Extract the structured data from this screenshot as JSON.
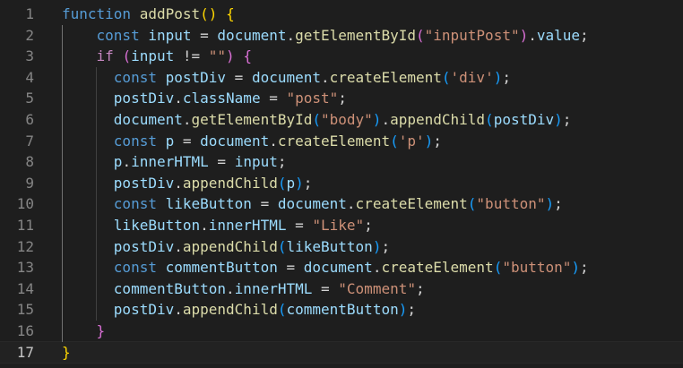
{
  "editor": {
    "active_line": 17,
    "lines": [
      {
        "number": "1",
        "tokens": [
          {
            "text": "function",
            "cls": "kw"
          },
          {
            "text": " "
          },
          {
            "text": "addPost",
            "cls": "fn"
          },
          {
            "text": "(",
            "cls": "b1"
          },
          {
            "text": ")",
            "cls": "b1"
          },
          {
            "text": " "
          },
          {
            "text": "{",
            "cls": "b1"
          }
        ]
      },
      {
        "number": "2",
        "tokens": [
          {
            "text": "    "
          },
          {
            "text": "const",
            "cls": "kw"
          },
          {
            "text": " "
          },
          {
            "text": "input",
            "cls": "var"
          },
          {
            "text": " = "
          },
          {
            "text": "document",
            "cls": "obj"
          },
          {
            "text": "."
          },
          {
            "text": "getElementById",
            "cls": "fn"
          },
          {
            "text": "(",
            "cls": "b2"
          },
          {
            "text": "\"inputPost\"",
            "cls": "str"
          },
          {
            "text": ")",
            "cls": "b2"
          },
          {
            "text": "."
          },
          {
            "text": "value",
            "cls": "var"
          },
          {
            "text": ";"
          }
        ]
      },
      {
        "number": "3",
        "tokens": [
          {
            "text": "    "
          },
          {
            "text": "if",
            "cls": "ctl"
          },
          {
            "text": " "
          },
          {
            "text": "(",
            "cls": "b2"
          },
          {
            "text": "input",
            "cls": "var"
          },
          {
            "text": " != "
          },
          {
            "text": "\"\"",
            "cls": "str"
          },
          {
            "text": ")",
            "cls": "b2"
          },
          {
            "text": " "
          },
          {
            "text": "{",
            "cls": "b2"
          }
        ]
      },
      {
        "number": "4",
        "tokens": [
          {
            "text": "      "
          },
          {
            "text": "const",
            "cls": "kw"
          },
          {
            "text": " "
          },
          {
            "text": "postDiv",
            "cls": "var"
          },
          {
            "text": " = "
          },
          {
            "text": "document",
            "cls": "obj"
          },
          {
            "text": "."
          },
          {
            "text": "createElement",
            "cls": "fn"
          },
          {
            "text": "(",
            "cls": "b3"
          },
          {
            "text": "'div'",
            "cls": "str"
          },
          {
            "text": ")",
            "cls": "b3"
          },
          {
            "text": ";"
          }
        ]
      },
      {
        "number": "5",
        "tokens": [
          {
            "text": "      "
          },
          {
            "text": "postDiv",
            "cls": "var"
          },
          {
            "text": "."
          },
          {
            "text": "className",
            "cls": "var"
          },
          {
            "text": " = "
          },
          {
            "text": "\"post\"",
            "cls": "str"
          },
          {
            "text": ";"
          }
        ]
      },
      {
        "number": "6",
        "tokens": [
          {
            "text": "      "
          },
          {
            "text": "document",
            "cls": "obj"
          },
          {
            "text": "."
          },
          {
            "text": "getElementById",
            "cls": "fn"
          },
          {
            "text": "(",
            "cls": "b3"
          },
          {
            "text": "\"body\"",
            "cls": "str"
          },
          {
            "text": ")",
            "cls": "b3"
          },
          {
            "text": "."
          },
          {
            "text": "appendChild",
            "cls": "fn"
          },
          {
            "text": "(",
            "cls": "b3"
          },
          {
            "text": "postDiv",
            "cls": "var"
          },
          {
            "text": ")",
            "cls": "b3"
          },
          {
            "text": ";"
          }
        ]
      },
      {
        "number": "7",
        "tokens": [
          {
            "text": "      "
          },
          {
            "text": "const",
            "cls": "kw"
          },
          {
            "text": " "
          },
          {
            "text": "p",
            "cls": "var"
          },
          {
            "text": " = "
          },
          {
            "text": "document",
            "cls": "obj"
          },
          {
            "text": "."
          },
          {
            "text": "createElement",
            "cls": "fn"
          },
          {
            "text": "(",
            "cls": "b3"
          },
          {
            "text": "'p'",
            "cls": "str"
          },
          {
            "text": ")",
            "cls": "b3"
          },
          {
            "text": ";"
          }
        ]
      },
      {
        "number": "8",
        "tokens": [
          {
            "text": "      "
          },
          {
            "text": "p",
            "cls": "var"
          },
          {
            "text": "."
          },
          {
            "text": "innerHTML",
            "cls": "var"
          },
          {
            "text": " = "
          },
          {
            "text": "input",
            "cls": "var"
          },
          {
            "text": ";"
          }
        ]
      },
      {
        "number": "9",
        "tokens": [
          {
            "text": "      "
          },
          {
            "text": "postDiv",
            "cls": "var"
          },
          {
            "text": "."
          },
          {
            "text": "appendChild",
            "cls": "fn"
          },
          {
            "text": "(",
            "cls": "b3"
          },
          {
            "text": "p",
            "cls": "var"
          },
          {
            "text": ")",
            "cls": "b3"
          },
          {
            "text": ";"
          }
        ]
      },
      {
        "number": "10",
        "tokens": [
          {
            "text": "      "
          },
          {
            "text": "const",
            "cls": "kw"
          },
          {
            "text": " "
          },
          {
            "text": "likeButton",
            "cls": "var"
          },
          {
            "text": " = "
          },
          {
            "text": "document",
            "cls": "obj"
          },
          {
            "text": "."
          },
          {
            "text": "createElement",
            "cls": "fn"
          },
          {
            "text": "(",
            "cls": "b3"
          },
          {
            "text": "\"button\"",
            "cls": "str"
          },
          {
            "text": ")",
            "cls": "b3"
          },
          {
            "text": ";"
          }
        ]
      },
      {
        "number": "11",
        "tokens": [
          {
            "text": "      "
          },
          {
            "text": "likeButton",
            "cls": "var"
          },
          {
            "text": "."
          },
          {
            "text": "innerHTML",
            "cls": "var"
          },
          {
            "text": " = "
          },
          {
            "text": "\"Like\"",
            "cls": "str"
          },
          {
            "text": ";"
          }
        ]
      },
      {
        "number": "12",
        "tokens": [
          {
            "text": "      "
          },
          {
            "text": "postDiv",
            "cls": "var"
          },
          {
            "text": "."
          },
          {
            "text": "appendChild",
            "cls": "fn"
          },
          {
            "text": "(",
            "cls": "b3"
          },
          {
            "text": "likeButton",
            "cls": "var"
          },
          {
            "text": ")",
            "cls": "b3"
          },
          {
            "text": ";"
          }
        ]
      },
      {
        "number": "13",
        "tokens": [
          {
            "text": "      "
          },
          {
            "text": "const",
            "cls": "kw"
          },
          {
            "text": " "
          },
          {
            "text": "commentButton",
            "cls": "var"
          },
          {
            "text": " = "
          },
          {
            "text": "document",
            "cls": "obj"
          },
          {
            "text": "."
          },
          {
            "text": "createElement",
            "cls": "fn"
          },
          {
            "text": "(",
            "cls": "b3"
          },
          {
            "text": "\"button\"",
            "cls": "str"
          },
          {
            "text": ")",
            "cls": "b3"
          },
          {
            "text": ";"
          }
        ]
      },
      {
        "number": "14",
        "tokens": [
          {
            "text": "      "
          },
          {
            "text": "commentButton",
            "cls": "var"
          },
          {
            "text": "."
          },
          {
            "text": "innerHTML",
            "cls": "var"
          },
          {
            "text": " = "
          },
          {
            "text": "\"Comment\"",
            "cls": "str"
          },
          {
            "text": ";"
          }
        ]
      },
      {
        "number": "15",
        "tokens": [
          {
            "text": "      "
          },
          {
            "text": "postDiv",
            "cls": "var"
          },
          {
            "text": "."
          },
          {
            "text": "appendChild",
            "cls": "fn"
          },
          {
            "text": "(",
            "cls": "b3"
          },
          {
            "text": "commentButton",
            "cls": "var"
          },
          {
            "text": ")",
            "cls": "b3"
          },
          {
            "text": ";"
          }
        ]
      },
      {
        "number": "16",
        "tokens": [
          {
            "text": "    "
          },
          {
            "text": "}",
            "cls": "b2"
          }
        ]
      },
      {
        "number": "17",
        "tokens": [
          {
            "text": "}",
            "cls": "b1"
          }
        ]
      }
    ]
  }
}
